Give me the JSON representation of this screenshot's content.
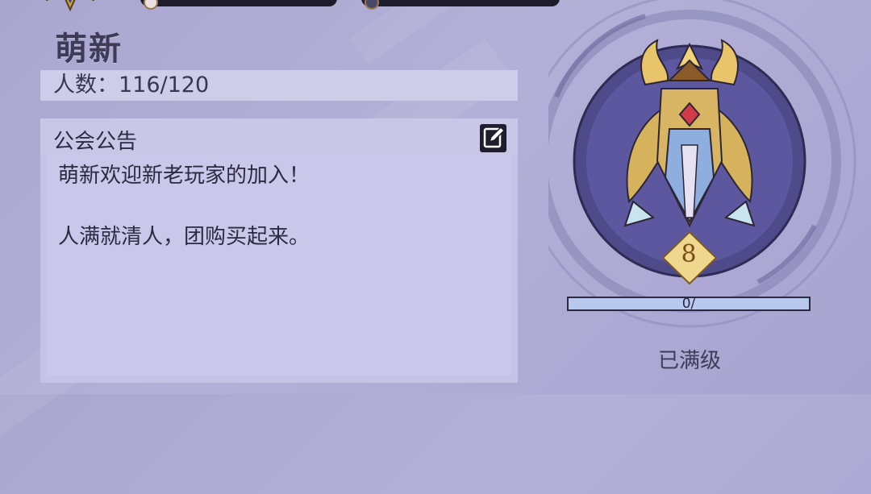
{
  "guild": {
    "name": "萌新",
    "members_label": "人数：116/120"
  },
  "notice": {
    "title": "公会公告",
    "lines": [
      "萌新欢迎新老玩家的加入！",
      "",
      "人满就清人，团购买起来。"
    ]
  },
  "badge": {
    "level": "8",
    "progress_text": "0/",
    "progress_fraction": 0,
    "status": "已满级"
  },
  "icons": {
    "edit": "edit-pencil-icon",
    "emblem": "guild-crest-emblem",
    "top_emblem": "rank-emblem-icon"
  },
  "colors": {
    "panel": "#cecce9",
    "dark": "#1f1d2e",
    "gold": "#d9b65a",
    "circle": "#4f4a8a"
  }
}
